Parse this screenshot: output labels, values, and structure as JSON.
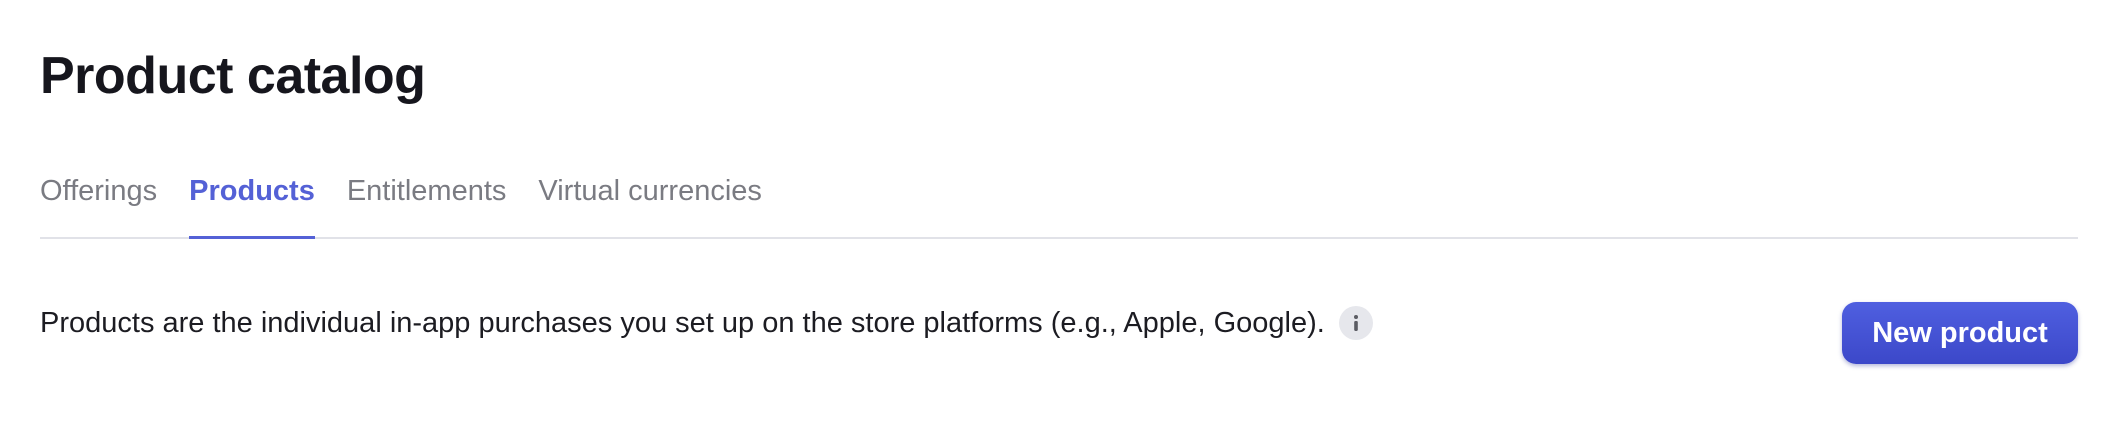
{
  "header": {
    "title": "Product catalog"
  },
  "tabs": [
    {
      "label": "Offerings",
      "active": false
    },
    {
      "label": "Products",
      "active": true
    },
    {
      "label": "Entitlements",
      "active": false
    },
    {
      "label": "Virtual currencies",
      "active": false
    }
  ],
  "main": {
    "description": "Products are the individual in-app purchases you set up on the store platforms (e.g., Apple, Google).",
    "info_icon": "info-icon",
    "new_product_label": "New product"
  },
  "colors": {
    "accent": "#5461d6",
    "button": "#4452d4",
    "title": "#16161d",
    "inactive_tab": "#7a7b82",
    "divider": "#e1e2e8"
  }
}
